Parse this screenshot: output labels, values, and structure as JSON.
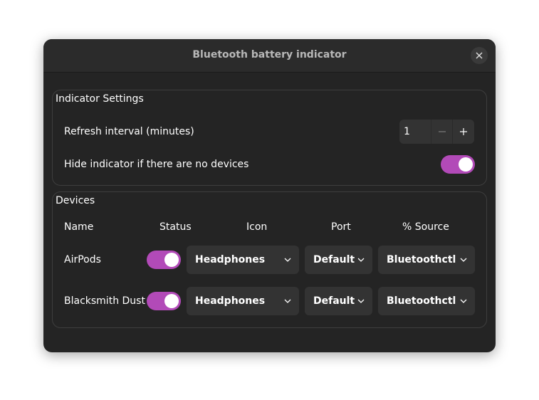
{
  "window": {
    "title": "Bluetooth battery indicator"
  },
  "settings": {
    "label": "Indicator Settings",
    "refresh_label": "Refresh interval (minutes)",
    "refresh_value": "1",
    "hide_label": "Hide indicator if there are no devices",
    "hide_enabled": true
  },
  "devices": {
    "label": "Devices",
    "headers": {
      "name": "Name",
      "status": "Status",
      "icon": "Icon",
      "port": "Port",
      "source": "% Source"
    },
    "rows": [
      {
        "name": "AirPods",
        "enabled": true,
        "icon": "Headphones",
        "port": "Default",
        "source": "Bluetoothctl"
      },
      {
        "name": "Blacksmith Dust",
        "enabled": true,
        "icon": "Headphones",
        "port": "Default",
        "source": "Bluetoothctl"
      }
    ]
  },
  "colors": {
    "accent": "#b24ab8",
    "window_bg": "#242424",
    "control_bg": "#333333"
  },
  "icons": {
    "close": "close-icon",
    "minus": "minus-icon",
    "plus": "plus-icon",
    "chevron": "chevron-down-icon"
  }
}
